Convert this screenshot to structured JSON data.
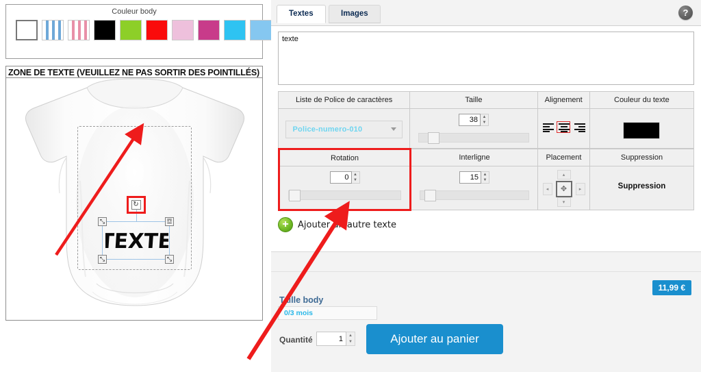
{
  "left": {
    "color_section_title": "Couleur body",
    "swatches": [
      {
        "name": "blanc",
        "hex": "#ffffff",
        "selected": true,
        "pattern": "none"
      },
      {
        "name": "raye-bleu",
        "hex": "#6ea8d8",
        "selected": false,
        "pattern": "stripes"
      },
      {
        "name": "raye-rose",
        "hex": "#e890a8",
        "selected": false,
        "pattern": "stripes"
      },
      {
        "name": "noir",
        "hex": "#000000",
        "selected": false,
        "pattern": "none"
      },
      {
        "name": "vert-anis",
        "hex": "#8dcf28",
        "selected": false,
        "pattern": "none"
      },
      {
        "name": "rouge",
        "hex": "#fa0b0b",
        "selected": false,
        "pattern": "none"
      },
      {
        "name": "rose-pale",
        "hex": "#eec0dc",
        "selected": false,
        "pattern": "none"
      },
      {
        "name": "fuchsia",
        "hex": "#c83b8a",
        "selected": false,
        "pattern": "none"
      },
      {
        "name": "cyan",
        "hex": "#2ec3f2",
        "selected": false,
        "pattern": "none"
      },
      {
        "name": "bleu-ciel",
        "hex": "#85c7f0",
        "selected": false,
        "pattern": "none"
      }
    ],
    "zone_label": "ZONE DE TEXTE (VEUILLEZ NE PAS SORTIR DES POINTILLÉS)",
    "preview_text": "TEXTE",
    "handles": {
      "rotate": "↻",
      "resize": "⤡",
      "delete": "☲"
    }
  },
  "tabs": [
    {
      "id": "textes",
      "label": "Textes",
      "active": true
    },
    {
      "id": "images",
      "label": "Images",
      "active": false
    }
  ],
  "help": {
    "label": "?"
  },
  "editor": {
    "textarea_value": "texte",
    "textarea_placeholder": "texte"
  },
  "props_row1": {
    "headers": [
      "Liste de Police de caractères",
      "Taille",
      "Alignement",
      "Couleur du texte"
    ],
    "font_value": "Police-numero-010",
    "taille_value": "38",
    "taille_slider_pct": 9,
    "alignment_options": [
      "left",
      "center",
      "right"
    ],
    "alignment_selected": "center",
    "text_color_hex": "#000000"
  },
  "props_row2": {
    "headers": [
      "Rotation",
      "Interligne",
      "Placement",
      "Suppression"
    ],
    "rotation_value": "0",
    "rotation_slider_pct": 0,
    "interligne_value": "15",
    "interligne_slider_pct": 4,
    "placement_arrows": {
      "up": "▴",
      "down": "▾",
      "left": "◂",
      "right": "▸",
      "center": "✥"
    },
    "suppression_label": "Suppression",
    "highlighted": "Rotation"
  },
  "add_text": {
    "icon": "plus-icon",
    "label": "Ajouter un autre texte"
  },
  "buy": {
    "price": "11,99 €",
    "size_label": "Taille body",
    "size_value": "0/3 mois",
    "quantity_label": "Quantité",
    "quantity_value": "1",
    "cart_button": "Ajouter au panier",
    "accent_hex": "#1a8fce"
  }
}
